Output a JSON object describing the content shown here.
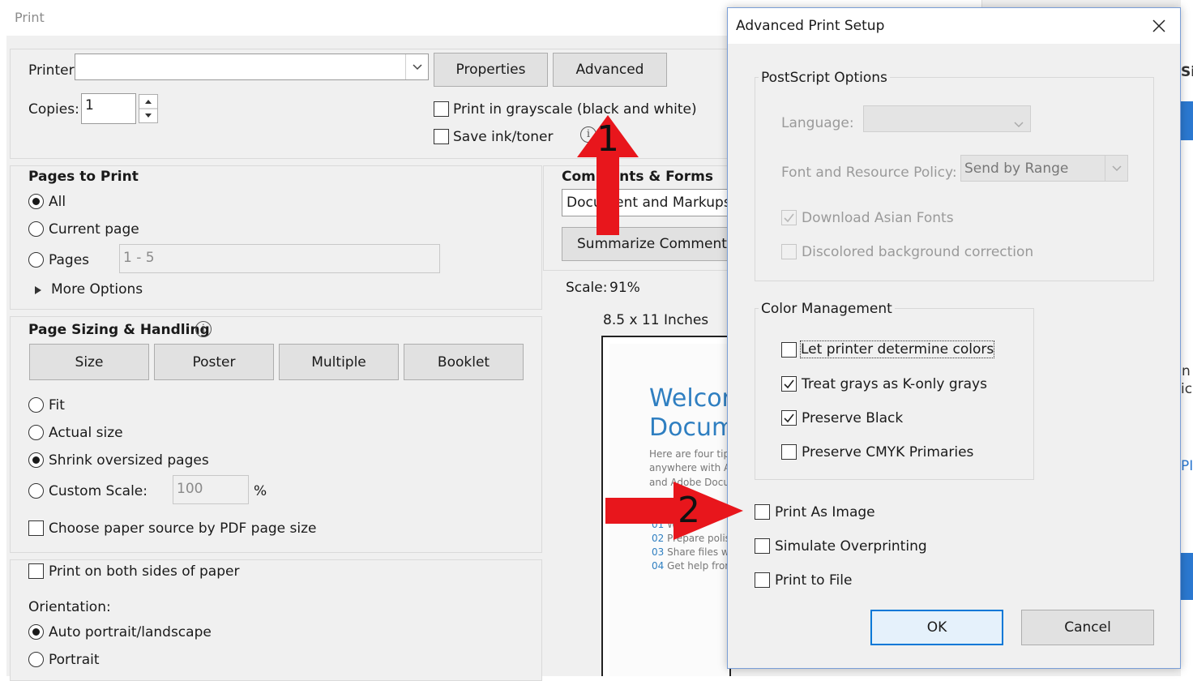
{
  "print_window": {
    "title": "Print",
    "printer_label": "Printer:",
    "printer_value": "",
    "properties_button": "Properties",
    "advanced_button": "Advanced",
    "copies_label": "Copies:",
    "copies_value": "1",
    "grayscale_label": "Print in grayscale (black and white)",
    "save_ink_label": "Save ink/toner",
    "pages_to_print": {
      "heading": "Pages to Print",
      "all": "All",
      "current_page": "Current page",
      "pages": "Pages",
      "pages_value": "1 - 5",
      "more_options": "More Options"
    },
    "comments_forms": {
      "heading": "Comments & Forms",
      "select_value": "Document and Markups",
      "summarize_button": "Summarize Comments"
    },
    "page_sizing": {
      "heading": "Page Sizing & Handling",
      "size_button": "Size",
      "poster_button": "Poster",
      "multiple_button": "Multiple",
      "booklet_button": "Booklet",
      "fit": "Fit",
      "actual_size": "Actual size",
      "shrink": "Shrink oversized pages",
      "custom_scale": "Custom Scale:",
      "custom_scale_value": "100",
      "percent": "%",
      "paper_source": "Choose paper source by PDF page size"
    },
    "both_sides": "Print on both sides of paper",
    "orientation": {
      "label": "Orientation:",
      "auto": "Auto portrait/landscape",
      "portrait": "Portrait"
    },
    "preview": {
      "scale_label": "Scale:",
      "scale_value": "91%",
      "paper_size": "8.5 x 11 Inches",
      "doc_title_1": "Welcor",
      "doc_title_2": "Docum",
      "doc_line_1": "Here are four tips",
      "doc_line_2": "anywhere with Ac",
      "doc_line_3": "and Adobe Docum",
      "tips": [
        {
          "num": "01",
          "text": "W"
        },
        {
          "num": "02",
          "text": "Prepare polish"
        },
        {
          "num": "03",
          "text": "Share files with"
        },
        {
          "num": "04",
          "text": "Get help from"
        }
      ]
    }
  },
  "advanced_dialog": {
    "title": "Advanced Print Setup",
    "postscript": {
      "group_label": "PostScript Options",
      "language_label": "Language:",
      "language_value": "",
      "font_policy_label": "Font and Resource Policy:",
      "font_policy_value": "Send by Range",
      "download_asian_fonts": "Download Asian Fonts",
      "discolored_bg": "Discolored background correction"
    },
    "color_management": {
      "group_label": "Color Management",
      "let_printer": "Let printer determine colors",
      "treat_grays": "Treat grays as K-only grays",
      "preserve_black": "Preserve Black",
      "preserve_cmyk": "Preserve CMYK Primaries"
    },
    "print_as_image": "Print As Image",
    "simulate_overprinting": "Simulate Overprinting",
    "print_to_file": "Print to File",
    "ok_button": "OK",
    "cancel_button": "Cancel"
  },
  "annotations": {
    "arrow_1_label": "1",
    "arrow_2_label": "2",
    "arrow_color": "#e8161c"
  },
  "side_window": {
    "fragment_1": "Si",
    "fragment_2": "n",
    "fragment_3": "ic",
    "fragment_4": "PI"
  }
}
